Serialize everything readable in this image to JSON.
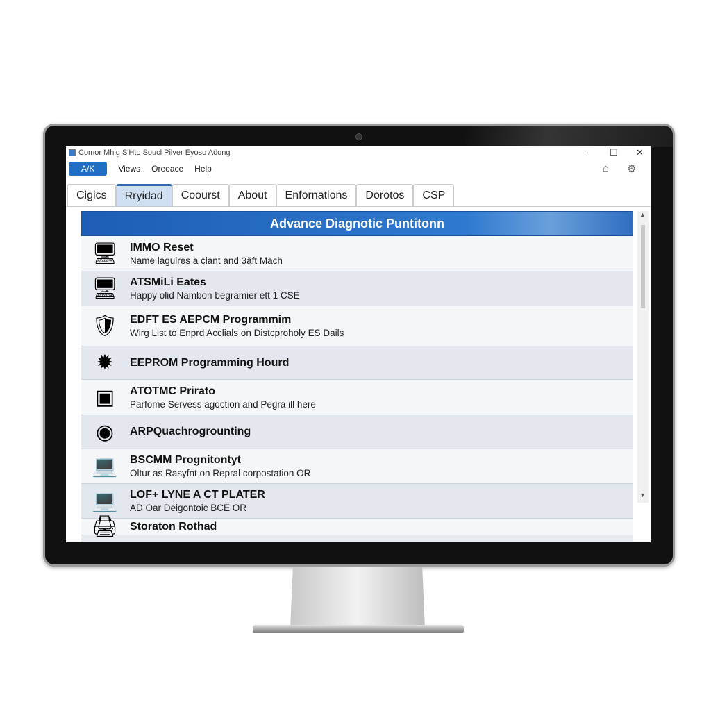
{
  "window": {
    "title": "Comor Mhig S'Hto Soucl Pilver Eyoso Aöong",
    "minimize": "–",
    "maximize": "☐",
    "close": "✕"
  },
  "menu": [
    {
      "label": "A/K"
    },
    {
      "label": "Views"
    },
    {
      "label": "Oreeace"
    },
    {
      "label": "Help"
    }
  ],
  "toolbar_icons": [
    "home-icon",
    "settings-icon"
  ],
  "tabs": [
    {
      "label": "Cigics"
    },
    {
      "label": "Rryidad",
      "selected": true
    },
    {
      "label": "Coourst"
    },
    {
      "label": "About"
    },
    {
      "label": "Enfornations"
    },
    {
      "label": "Dorotos"
    },
    {
      "label": "CSP"
    }
  ],
  "panel": {
    "header": "Advance Diagnotic Puntitonn"
  },
  "items": [
    {
      "title": "IMMO Reset",
      "subtitle": "Name laguires a clant and 3äft Mach",
      "icon": "monitor-icon"
    },
    {
      "title": "ATSMiLi Eates",
      "subtitle": "Happy olid Nambon begramier ett 1 CSE",
      "icon": "monitor-icon"
    },
    {
      "title": "EDFT ES AEPCM Programmim",
      "subtitle": "Wirg List to Enprd Acclials on Distcproholy ES Dails",
      "icon": "shield-icon"
    },
    {
      "title": "EEPROM Programming Hourd",
      "subtitle": "",
      "icon": "chip-icon"
    },
    {
      "title": "ATOTMC Prirato",
      "subtitle": "Parfome Servess agoction and Pegra ill here",
      "icon": "devices-icon"
    },
    {
      "title": "ARPQuachrogrounting",
      "subtitle": "",
      "icon": "disc-icon"
    },
    {
      "title": "BSCMM Prognitontyt",
      "subtitle": "Oltur as Rasyfnt on Repral corpostation OR",
      "icon": "laptop-icon"
    },
    {
      "title": "LOF+ LYNE A CT PLATER",
      "subtitle": "AD Oar Deigontoic BCE OR",
      "icon": "laptop-icon"
    },
    {
      "title": "Storaton Rothad",
      "subtitle": "",
      "icon": "printer-icon"
    }
  ],
  "colors": {
    "accent": "#1f6fc4",
    "header": "#2f7ad0"
  }
}
